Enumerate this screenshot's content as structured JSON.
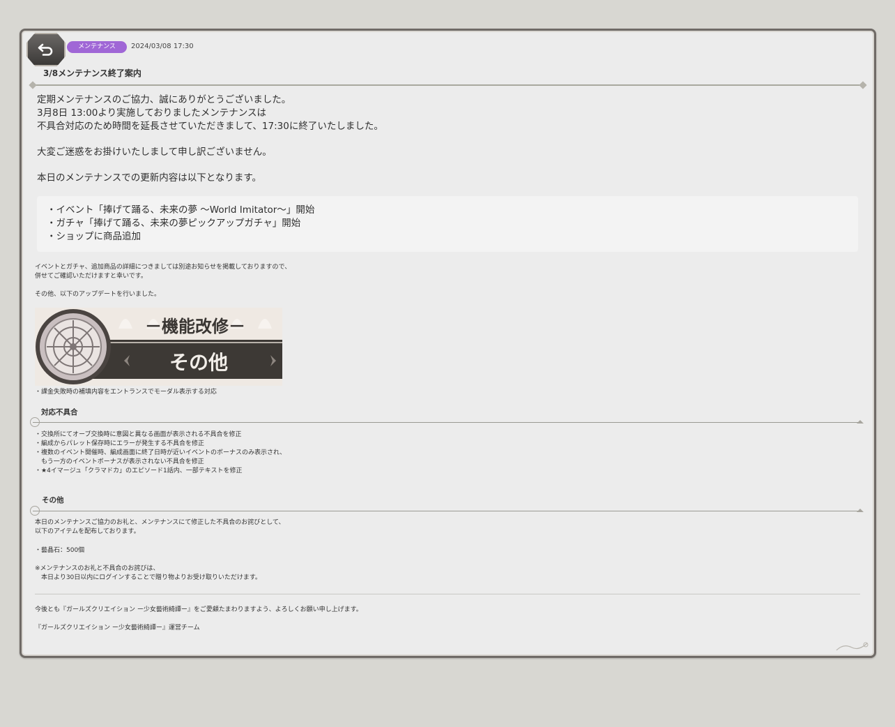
{
  "header": {
    "back_icon": "back-arrow-icon",
    "tag_label": "メンテナンス",
    "tag_color": "#a067d6",
    "date": "2024/03/08 17:30",
    "title": "3/8メンテナンス終了案内"
  },
  "intro": {
    "line1": "定期メンテナンスのご協力、誠にありがとうございました。",
    "line2": "3月8日 13:00より実施しておりましたメンテナンスは",
    "line3": "不具合対応のため時間を延長させていただきまして、17:30に終了いたしました。",
    "line4": "大変ご迷惑をお掛けいたしまして申し訳ございません。",
    "line5": "本日のメンテナンスでの更新内容は以下となります。"
  },
  "updates": [
    "・イベント「捧げて踊る、未来の夢 〜World Imitator〜」開始",
    "・ガチャ「捧げて踊る、未来の夢ピックアップガチャ」開始",
    "・ショップに商品追加"
  ],
  "notes": {
    "line1": "イベントとガチャ、追加商品の詳細につきましては別途お知らせを掲載しておりますので、",
    "line2": "併せてご確認いただけますと幸いです。",
    "line3": "その他、以下のアップデートを行いました。"
  },
  "banner": {
    "top_text": "－機能改修－",
    "bottom_text": "その他"
  },
  "feature_item": "・課金失敗時の補填内容をエントランスでモーダル表示する対応",
  "bugs": {
    "heading": "対応不具合",
    "items": [
      "・交換所にてオーブ交換時に意図と異なる画面が表示される不具合を修正",
      "・編成からパレット保存時にエラーが発生する不具合を修正",
      "・複数のイベント開催時、編成画面に終了日時が近いイベントのボーナスのみ表示され、",
      "　もう一方のイベントボーナスが表示されない不具合を修正",
      "・★4イマージュ「クラマドカ」のエピソード1話内、一部テキストを修正"
    ]
  },
  "other": {
    "heading": "その他",
    "line1": "本日のメンテナンスご協力のお礼と、メンテナンスにて修正した不具合のお詫びとして、",
    "line2": "以下のアイテムを配布しております。",
    "item": "・藝晶石：500個",
    "note1": "※メンテナンスのお礼と不具合のお詫びは、",
    "note2": "　本日より30日以内にログインすることで贈り物よりお受け取りいただけます。"
  },
  "footer": {
    "line1": "今後とも『ガールズクリエイション ー少女藝術綺譚ー』をご愛顧たまわりますよう、よろしくお願い申し上げます。",
    "line2": "『ガールズクリエイション ー少女藝術綺譚ー』運営チーム"
  }
}
